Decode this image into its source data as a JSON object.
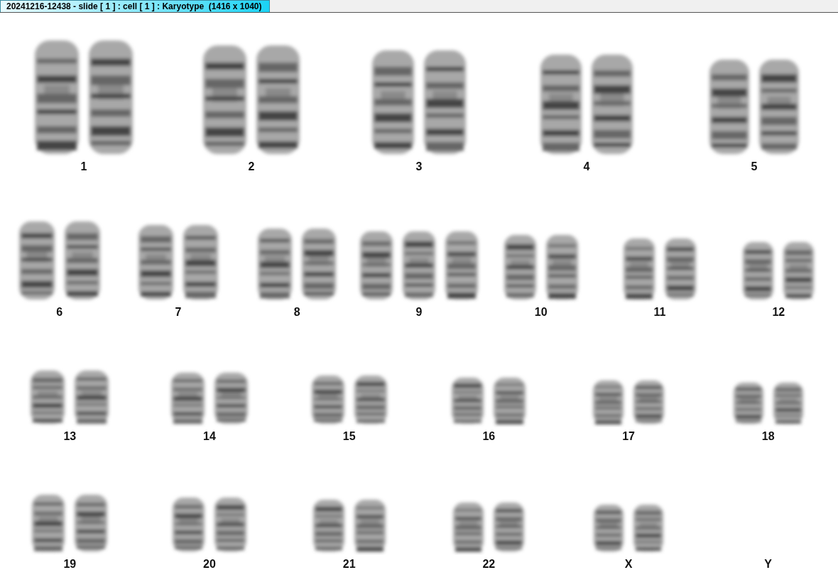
{
  "window": {
    "title": "20241216-12438 - slide [ 1 ] : cell [ 1 ] : Karyotype  (1416 x 1040)"
  },
  "karyotype": {
    "rows": [
      {
        "groups": [
          {
            "label": "1",
            "items": [
              {
                "kind": "chromosome"
              },
              {
                "kind": "chromosome"
              }
            ]
          },
          {
            "label": "2",
            "items": [
              {
                "kind": "chromosome"
              },
              {
                "kind": "chromosome"
              }
            ]
          },
          {
            "label": "3",
            "items": [
              {
                "kind": "chromosome"
              },
              {
                "kind": "chromosome"
              }
            ]
          },
          {
            "label": "4",
            "items": [
              {
                "kind": "chromosome"
              },
              {
                "kind": "chromosome"
              }
            ]
          },
          {
            "label": "5",
            "items": [
              {
                "kind": "chromosome"
              },
              {
                "kind": "chromosome"
              }
            ]
          }
        ]
      },
      {
        "groups": [
          {
            "label": "6",
            "items": [
              {
                "kind": "chromosome"
              },
              {
                "kind": "chromosome"
              }
            ]
          },
          {
            "label": "7",
            "items": [
              {
                "kind": "chromosome"
              },
              {
                "kind": "chromosome"
              }
            ]
          },
          {
            "label": "8",
            "items": [
              {
                "kind": "chromosome"
              },
              {
                "kind": "chromosome"
              }
            ]
          },
          {
            "label": "9",
            "items": [
              {
                "kind": "chromosome"
              },
              {
                "kind": "chromosome"
              },
              {
                "kind": "chromosome"
              }
            ]
          },
          {
            "label": "10",
            "items": [
              {
                "kind": "chromosome"
              },
              {
                "kind": "chromosome"
              }
            ]
          },
          {
            "label": "11",
            "items": [
              {
                "kind": "chromosome"
              },
              {
                "kind": "chromosome"
              }
            ]
          },
          {
            "label": "12",
            "items": [
              {
                "kind": "chromosome"
              },
              {
                "kind": "chromosome"
              }
            ]
          }
        ]
      },
      {
        "groups": [
          {
            "label": "13",
            "items": [
              {
                "kind": "chromosome"
              },
              {
                "kind": "chromosome"
              }
            ]
          },
          {
            "label": "14",
            "items": [
              {
                "kind": "chromosome"
              },
              {
                "kind": "chromosome"
              }
            ]
          },
          {
            "label": "15",
            "items": [
              {
                "kind": "chromosome"
              },
              {
                "kind": "chromosome"
              }
            ]
          },
          {
            "label": "16",
            "items": [
              {
                "kind": "chromosome"
              },
              {
                "kind": "chromosome"
              }
            ]
          },
          {
            "label": "17",
            "items": [
              {
                "kind": "chromosome"
              },
              {
                "kind": "chromosome"
              }
            ]
          },
          {
            "label": "18",
            "items": [
              {
                "kind": "chromosome"
              },
              {
                "kind": "chromosome"
              }
            ]
          }
        ]
      },
      {
        "groups": [
          {
            "label": "19",
            "items": [
              {
                "kind": "chromosome"
              },
              {
                "kind": "chromosome"
              }
            ]
          },
          {
            "label": "20",
            "items": [
              {
                "kind": "chromosome"
              },
              {
                "kind": "chromosome"
              }
            ]
          },
          {
            "label": "21",
            "items": [
              {
                "kind": "chromosome"
              },
              {
                "kind": "chromosome"
              }
            ]
          },
          {
            "label": "22",
            "items": [
              {
                "kind": "chromosome"
              },
              {
                "kind": "chromosome"
              }
            ]
          },
          {
            "label": "X",
            "items": [
              {
                "kind": "chromosome"
              },
              {
                "kind": "chromosome"
              }
            ]
          },
          {
            "label": "Y"
          }
        ]
      }
    ]
  }
}
